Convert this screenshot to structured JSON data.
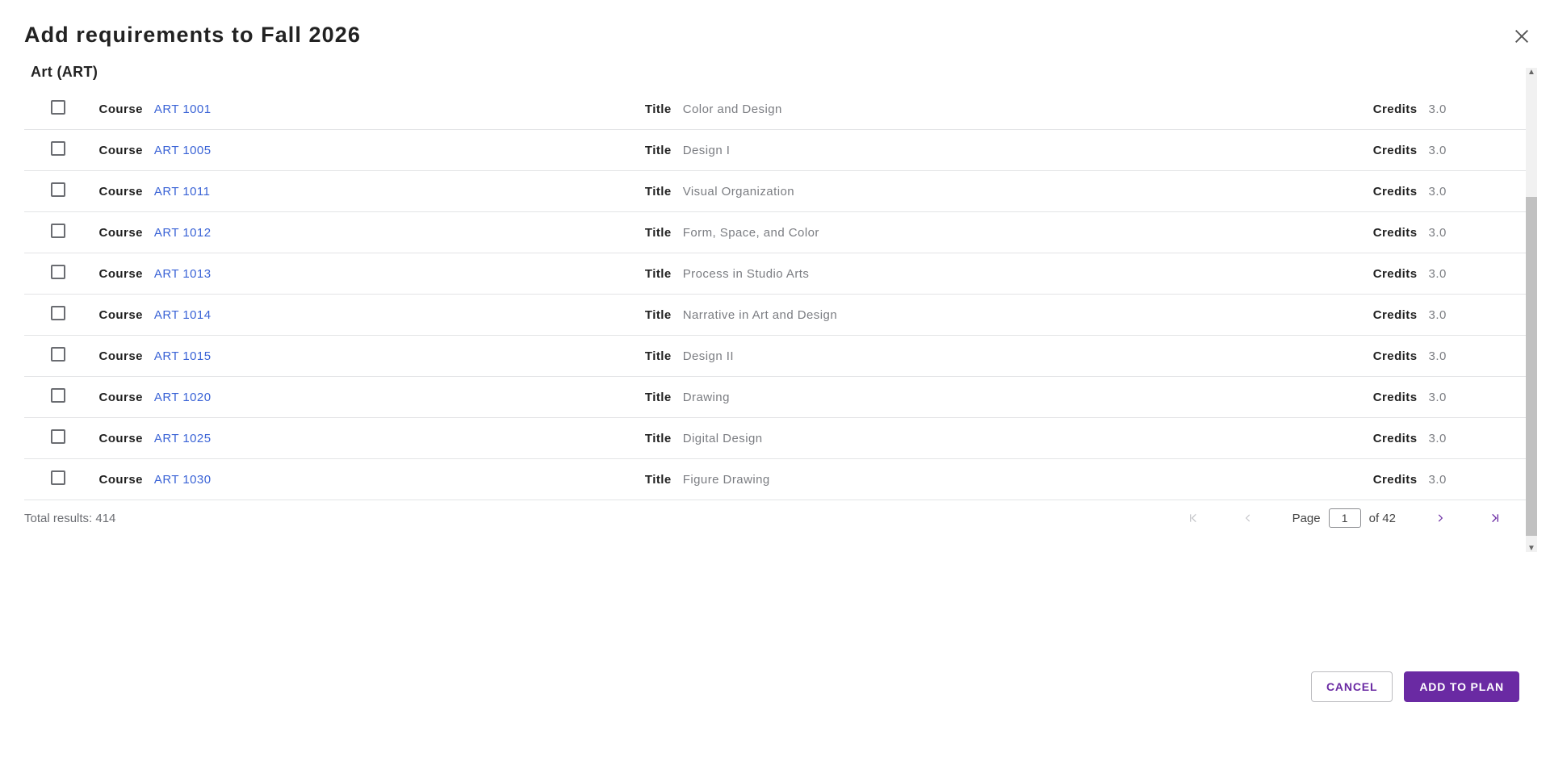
{
  "dialog": {
    "title": "Add requirements to Fall 2026",
    "group_heading": "Art (ART)",
    "labels": {
      "course": "Course",
      "title": "Title",
      "credits": "Credits"
    }
  },
  "courses": [
    {
      "code": "ART 1001",
      "title": "Color and Design",
      "credits": "3.0"
    },
    {
      "code": "ART 1005",
      "title": "Design I",
      "credits": "3.0"
    },
    {
      "code": "ART 1011",
      "title": "Visual Organization",
      "credits": "3.0"
    },
    {
      "code": "ART 1012",
      "title": "Form, Space, and Color",
      "credits": "3.0"
    },
    {
      "code": "ART 1013",
      "title": "Process in Studio Arts",
      "credits": "3.0"
    },
    {
      "code": "ART 1014",
      "title": "Narrative in Art and Design",
      "credits": "3.0"
    },
    {
      "code": "ART 1015",
      "title": "Design II",
      "credits": "3.0"
    },
    {
      "code": "ART 1020",
      "title": "Drawing",
      "credits": "3.0"
    },
    {
      "code": "ART 1025",
      "title": "Digital Design",
      "credits": "3.0"
    },
    {
      "code": "ART 1030",
      "title": "Figure Drawing",
      "credits": "3.0"
    }
  ],
  "pager": {
    "total_label": "Total results: 414",
    "page_label": "Page",
    "page_value": "1",
    "of_label": "of 42"
  },
  "footer": {
    "cancel": "CANCEL",
    "add": "ADD TO PLAN"
  }
}
